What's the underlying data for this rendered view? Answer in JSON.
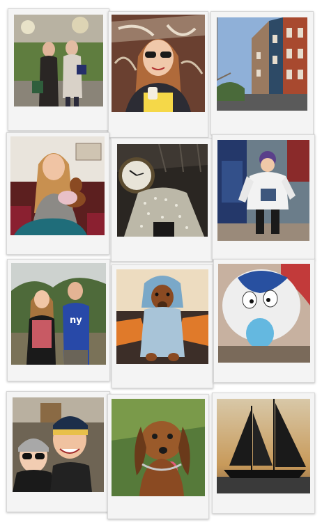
{
  "collage": {
    "photos": [
      {
        "id": "p1",
        "subject": "two-women-holiday-street"
      },
      {
        "id": "p2",
        "subject": "woman-sunglasses-graffiti-wall"
      },
      {
        "id": "p3",
        "subject": "brick-rowhouse-street"
      },
      {
        "id": "p4",
        "subject": "woman-with-dachshund-on-couch"
      },
      {
        "id": "p5",
        "subject": "station-clock-and-chandelier"
      },
      {
        "id": "p6",
        "subject": "fan-in-seahawks-jersey-super-bowl"
      },
      {
        "id": "p7",
        "subject": "couple-in-orchard"
      },
      {
        "id": "p8",
        "subject": "dachshund-in-dragon-costume"
      },
      {
        "id": "p9",
        "subject": "parade-balloon"
      },
      {
        "id": "p10",
        "subject": "couple-selfie-winter-hats"
      },
      {
        "id": "p11",
        "subject": "brown-dog-tongue-out"
      },
      {
        "id": "p12",
        "subject": "schooner-sunset"
      }
    ],
    "colors": {
      "frame": "#f4f4f4",
      "seahawks_blue": "#1f3c68",
      "giants_blue": "#2849a8",
      "dachshund_brown": "#8a4a22",
      "sunset": "#c89a5a"
    }
  }
}
